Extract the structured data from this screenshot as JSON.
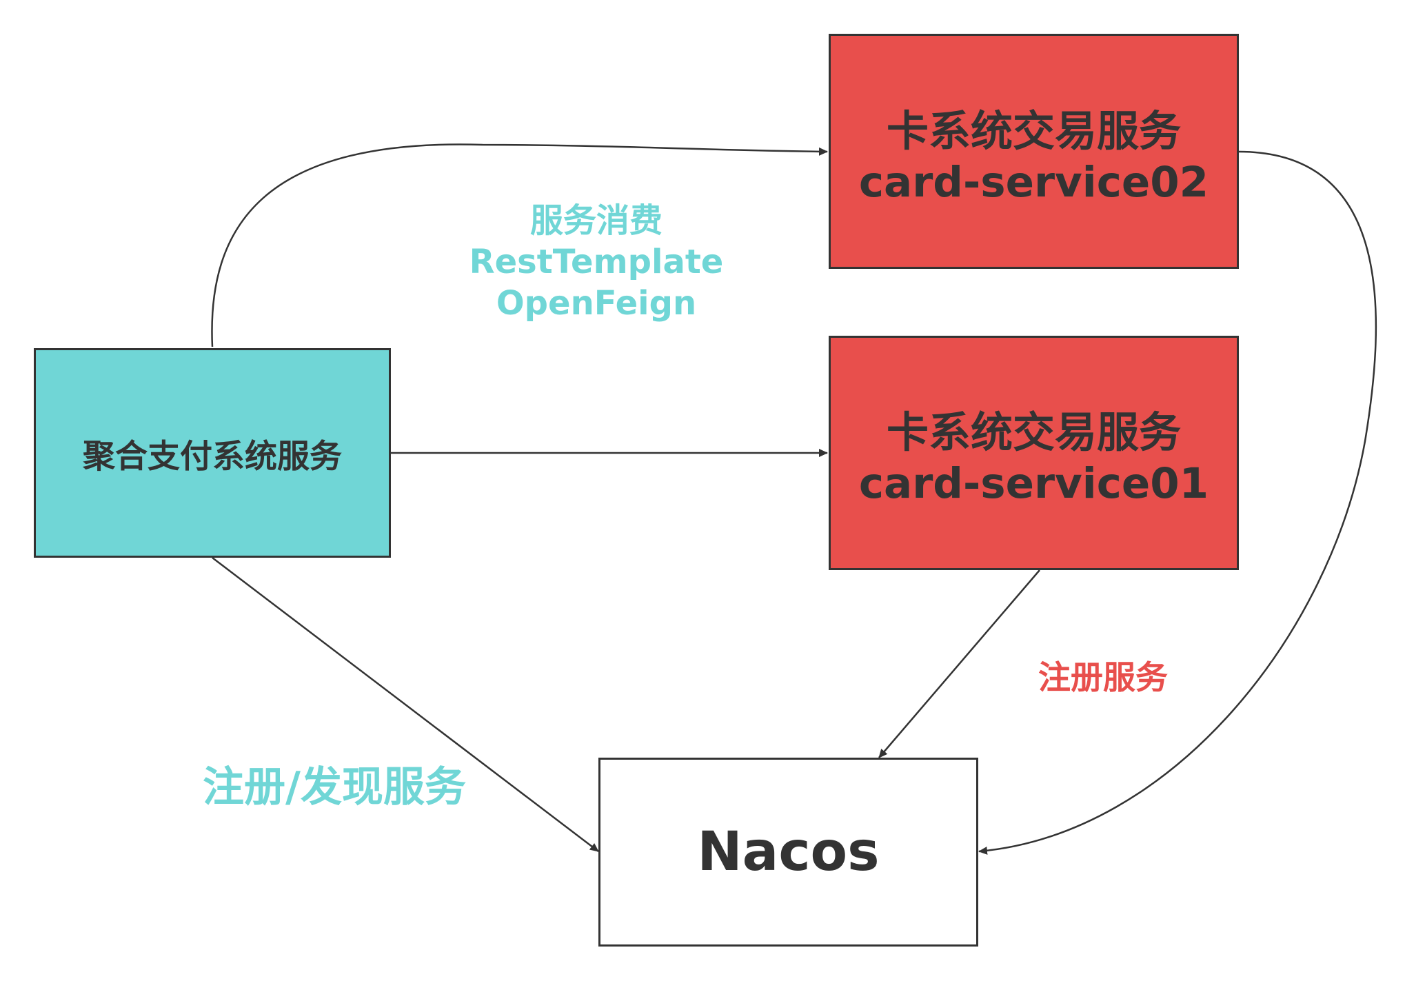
{
  "nodes": {
    "aggregator": {
      "label": "聚合支付系统服务",
      "fill": "#70D6D6"
    },
    "card02": {
      "line1": "卡系统交易服务",
      "line2": "card-service02",
      "fill": "#E84F4C"
    },
    "card01": {
      "line1": "卡系统交易服务",
      "line2": "card-service01",
      "fill": "#E84F4C"
    },
    "nacos": {
      "label": "Nacos",
      "fill": "#FFFFFF"
    }
  },
  "edge_labels": {
    "consume": {
      "line1": "服务消费",
      "line2": "RestTemplate",
      "line3": "OpenFeign",
      "color": "#70D6D6"
    },
    "register": {
      "text": "注册服务",
      "color": "#E84F4C"
    },
    "register_discover": {
      "text": "注册/发现服务",
      "color": "#70D6D6"
    }
  },
  "colors": {
    "stroke": "#333333",
    "text": "#333333"
  }
}
